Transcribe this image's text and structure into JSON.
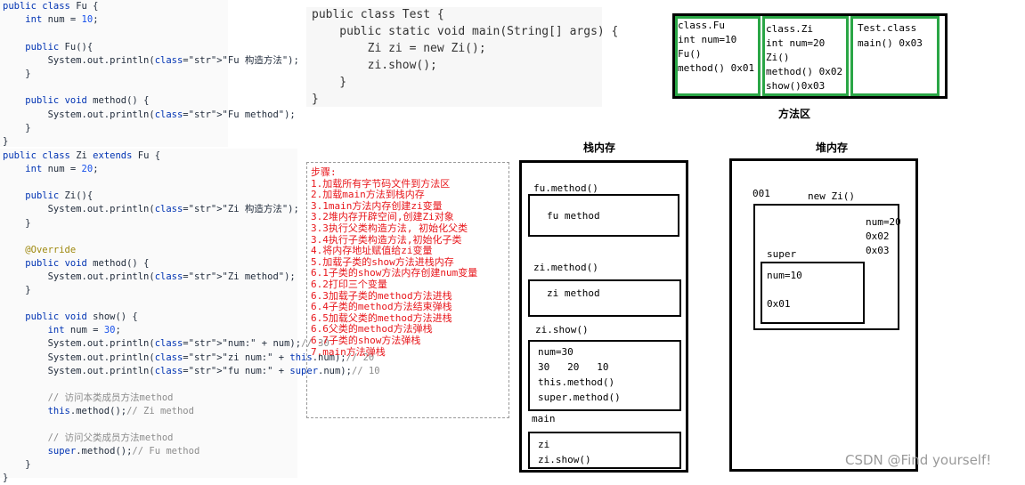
{
  "fu_class_code": [
    "public class Fu {",
    "    int num = 10;",
    "",
    "    public Fu(){",
    "        System.out.println(\"Fu 构造方法\");",
    "    }",
    "",
    "    public void method() {",
    "        System.out.println(\"Fu method\");",
    "    }",
    "}"
  ],
  "zi_class_code": [
    "public class Zi extends Fu {",
    "    int num = 20;",
    "",
    "    public Zi(){",
    "        System.out.println(\"Zi 构造方法\");",
    "    }",
    "",
    "    @Override",
    "    public void method() {",
    "        System.out.println(\"Zi method\");",
    "    }",
    "",
    "    public void show() {",
    "        int num = 30;",
    "        System.out.println(\"num:\" + num);// 30",
    "        System.out.println(\"zi num:\" + this.num);// 20",
    "        System.out.println(\"fu num:\" + super.num);// 10",
    "",
    "        // 访问本类成员方法method",
    "        this.method();// Zi method",
    "",
    "        // 访问父类成员方法method",
    "        super.method();// Fu method",
    "    }",
    "}"
  ],
  "test_class_code": [
    "public class Test {",
    "    public static void main(String[] args) {",
    "        Zi zi = new Zi();",
    "        zi.show();",
    "    }",
    "}"
  ],
  "steps": [
    "步骤:",
    "1.加载所有字节码文件到方法区",
    "2.加载main方法到栈内存",
    "3.1main方法内存创建zi变量",
    "3.2堆内存开辟空间,创建Zi对象",
    "3.3执行父类构造方法, 初始化父类",
    "3.4执行子类构造方法,初始化子类",
    "4.将内存地址赋值给zi变量",
    "5.加载子类的show方法进栈内存",
    "6.1子类的show方法内存创建num变量",
    "6.2打印三个变量",
    "6.3加载子类的method方法进栈",
    "6.4子类的method方法结束弹栈",
    "6.5加载父类的method方法进栈",
    "6.6父类的method方法弹栈",
    "6.7子类的show方法弹栈",
    "7.main方法弹栈"
  ],
  "method_area": {
    "label": "方法区",
    "fu": [
      "class.Fu",
      "int num=10",
      "Fu()",
      "method() 0x01"
    ],
    "zi": [
      "class.Zi",
      "int num=20",
      "Zi()",
      "method() 0x02",
      "show()0x03"
    ],
    "test": [
      "Test.class",
      "main() 0x03"
    ]
  },
  "stack": {
    "label": "栈内存",
    "fu_method_title": "fu.method()",
    "fu_method_body": "fu method",
    "zi_method_title": "zi.method()",
    "zi_method_body": "zi method",
    "zi_show_title": "zi.show()",
    "zi_show_body": [
      "num=30",
      "30   20   10",
      "this.method()",
      "super.method()"
    ],
    "main_title": "main",
    "main_body": [
      "zi",
      "zi.show()"
    ]
  },
  "heap": {
    "label": "堆内存",
    "address": "001",
    "new_label": "new Zi()",
    "zi_fields": [
      "num=20",
      "0x02",
      "0x03"
    ],
    "super_label": "super",
    "super_fields": [
      "num=10",
      "",
      "0x01"
    ]
  },
  "watermark": "CSDN @Find yourself!"
}
